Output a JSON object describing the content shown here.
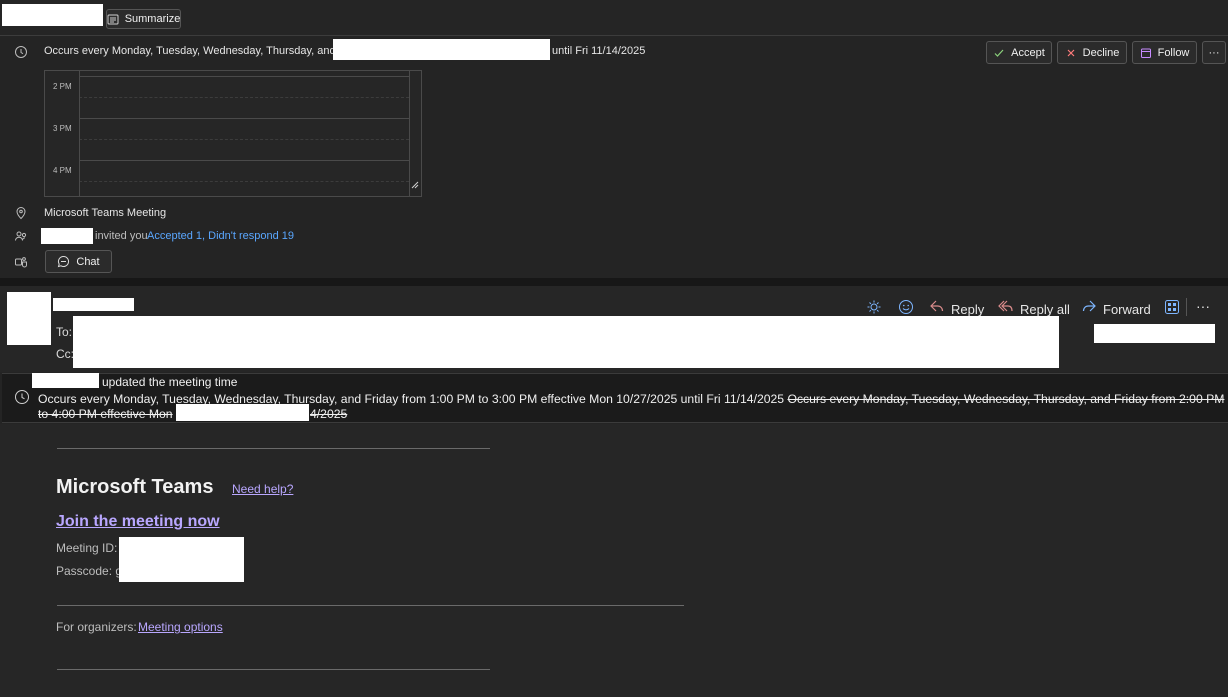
{
  "topbar": {
    "summarize_label": "Summarize"
  },
  "meeting_card": {
    "recurrence_prefix": "Occurs every Monday, Tuesday, Wednesday, Thursday, and Friday fr",
    "recurrence_suffix": "until Fri 11/14/2025",
    "actions": {
      "accept": "Accept",
      "decline": "Decline",
      "follow": "Follow",
      "more": "···"
    },
    "schedule_times": [
      "2 PM",
      "3 PM",
      "4 PM"
    ],
    "location": "Microsoft Teams Meeting",
    "invited_text": "invited you",
    "response_summary": "Accepted 1, Didn't respond 19",
    "chat_label": "Chat"
  },
  "message_header": {
    "to_label": "To:",
    "cc_label": "Cc:",
    "actions": {
      "reply": "Reply",
      "reply_all": "Reply all",
      "forward": "Forward",
      "more": "···"
    }
  },
  "update_banner": {
    "updated_text": "updated the meeting time",
    "new_schedule": "Occurs every Monday, Tuesday, Wednesday, Thursday, and Friday from 1:00 PM to 3:00 PM effective Mon 10/27/2025 until Fri 11/14/2025",
    "old_schedule_line1": "Occurs every Monday, Tuesday, Wednesday, Thursday, and Friday from 2:00 PM",
    "old_schedule_line2_prefix": "to 4:00 PM effective Mon",
    "old_schedule_line2_suffix": "4/2025"
  },
  "teams_body": {
    "title": "Microsoft Teams",
    "need_help": "Need help?",
    "join_link": "Join the meeting now",
    "meeting_id_label": "Meeting ID:",
    "passcode_label": "Passcode: g",
    "for_organizers_label": "For organizers:",
    "meeting_options_link": "Meeting options"
  }
}
